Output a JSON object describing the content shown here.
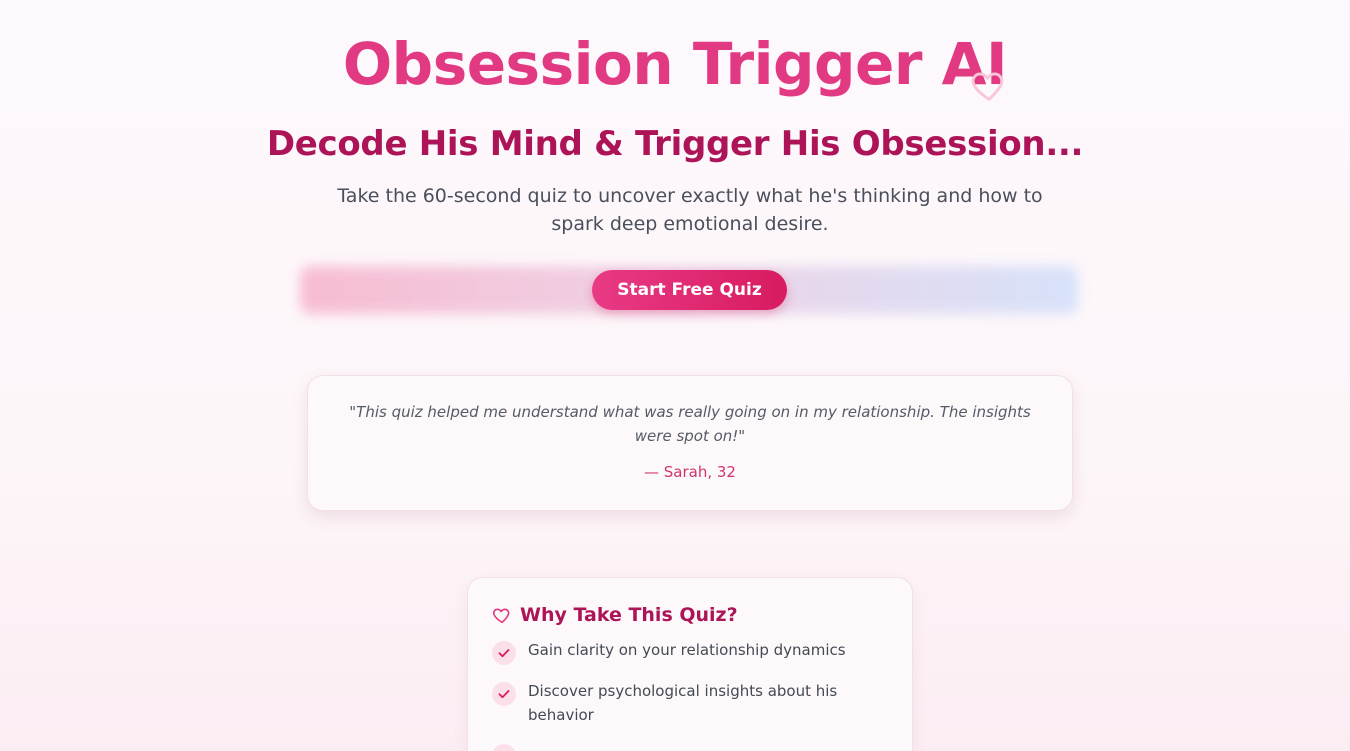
{
  "hero": {
    "title": "Obsession Trigger AI",
    "subtitle": "Decode His Mind & Trigger His Obsession...",
    "lead": "Take the 60-second quiz to uncover exactly what he's thinking and how to spark deep emotional desire.",
    "cta_label": "Start Free Quiz"
  },
  "testimonial": {
    "quote": "\"This quiz helped me understand what was really going on in my relationship. The insights were spot on!\"",
    "author": "— Sarah, 32"
  },
  "why": {
    "title": "Why Take This Quiz?",
    "items": [
      {
        "text": "Gain clarity on your relationship dynamics"
      },
      {
        "text": "Discover psychological insights about his behavior"
      },
      {
        "text": ""
      }
    ]
  },
  "colors": {
    "accent": "#e23a82",
    "heading": "#ad1457",
    "button": "#d81b60",
    "check_bg": "#fbe0ea"
  },
  "icons": [
    "heart-icon",
    "check-icon"
  ]
}
